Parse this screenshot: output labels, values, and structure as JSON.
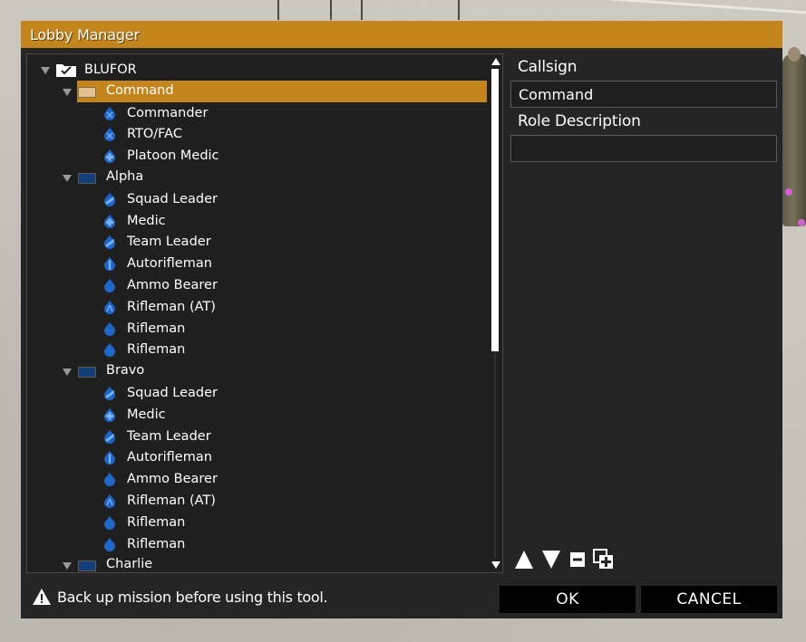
{
  "window": {
    "title": "Lobby Manager"
  },
  "colors": {
    "accent": "#c4851c",
    "blufor": "#123f7a",
    "command_swatch": "#e1c092",
    "bluefor_icon": "#1f66c9"
  },
  "tree": {
    "root": {
      "label": "BLUFOR",
      "icon": "folder-check-icon"
    },
    "groups": [
      {
        "label": "Command",
        "selected": true,
        "swatch": "tan",
        "roles": [
          {
            "label": "Commander",
            "icon": "commander-role-icon"
          },
          {
            "label": "RTO/FAC",
            "icon": "rto-role-icon"
          },
          {
            "label": "Platoon Medic",
            "icon": "medic-role-icon"
          }
        ]
      },
      {
        "label": "Alpha",
        "selected": false,
        "swatch": "blue",
        "roles": [
          {
            "label": "Squad Leader",
            "icon": "leader-role-icon"
          },
          {
            "label": "Medic",
            "icon": "medic-role-icon"
          },
          {
            "label": "Team Leader",
            "icon": "leader-role-icon"
          },
          {
            "label": "Autorifleman",
            "icon": "autorifleman-role-icon"
          },
          {
            "label": "Ammo Bearer",
            "icon": "rifleman-role-icon"
          },
          {
            "label": "Rifleman (AT)",
            "icon": "at-role-icon"
          },
          {
            "label": "Rifleman",
            "icon": "rifleman-role-icon"
          },
          {
            "label": "Rifleman",
            "icon": "rifleman-role-icon"
          }
        ]
      },
      {
        "label": "Bravo",
        "selected": false,
        "swatch": "blue",
        "roles": [
          {
            "label": "Squad Leader",
            "icon": "leader-role-icon"
          },
          {
            "label": "Medic",
            "icon": "medic-role-icon"
          },
          {
            "label": "Team Leader",
            "icon": "leader-role-icon"
          },
          {
            "label": "Autorifleman",
            "icon": "autorifleman-role-icon"
          },
          {
            "label": "Ammo Bearer",
            "icon": "rifleman-role-icon"
          },
          {
            "label": "Rifleman (AT)",
            "icon": "at-role-icon"
          },
          {
            "label": "Rifleman",
            "icon": "rifleman-role-icon"
          },
          {
            "label": "Rifleman",
            "icon": "rifleman-role-icon"
          }
        ]
      },
      {
        "label": "Charlie",
        "selected": false,
        "swatch": "blue",
        "roles": []
      }
    ]
  },
  "side_panel": {
    "callsign_label": "Callsign",
    "callsign_value": "Command",
    "role_description_label": "Role Description",
    "role_description_value": "",
    "controls": [
      {
        "name": "move-up-button",
        "icon": "arrow-up-icon"
      },
      {
        "name": "move-down-button",
        "icon": "arrow-down-icon"
      },
      {
        "name": "remove-button",
        "icon": "minus-icon"
      },
      {
        "name": "duplicate-button",
        "icon": "duplicate-add-icon"
      }
    ]
  },
  "footer": {
    "warning_text": "Back up mission before using this tool.",
    "warning_icon": "warning-icon",
    "ok_label": "OK",
    "cancel_label": "CANCEL"
  }
}
